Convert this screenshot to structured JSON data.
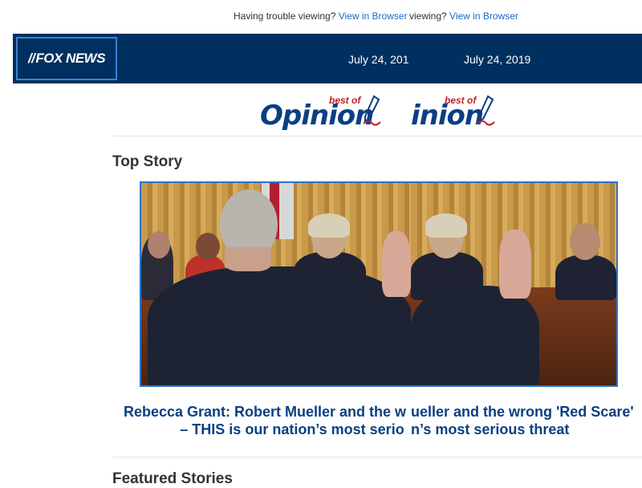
{
  "preheader": {
    "trouble_text": "Having trouble viewing?",
    "trouble_text_clipped": "viewing?",
    "view_link": "View in Browser"
  },
  "header": {
    "logo_text": "FOX NEWS",
    "date": "July 24, 2019",
    "date_clipped": "July 24, 201"
  },
  "banner": {
    "word": "Opinion",
    "word_clipped": "inion",
    "tag": "best of"
  },
  "top_story": {
    "section_title": "Top Story",
    "headline_line1": "Rebecca Grant: Robert Mueller and the w",
    "headline_line1_clipped": "ueller and the wrong 'Red Scare'",
    "headline_line2": "– THIS is our nation’s most serio",
    "headline_line2_clipped": "n’s most serious threat",
    "image_alt": "Robert Mueller sworn in before committee"
  },
  "featured": {
    "section_title": "Featured Stories"
  },
  "colors": {
    "brand_navy": "#00305f",
    "link_blue": "#1b66c9",
    "headline_blue": "#0a3f83",
    "accent_red": "#c0202a"
  }
}
